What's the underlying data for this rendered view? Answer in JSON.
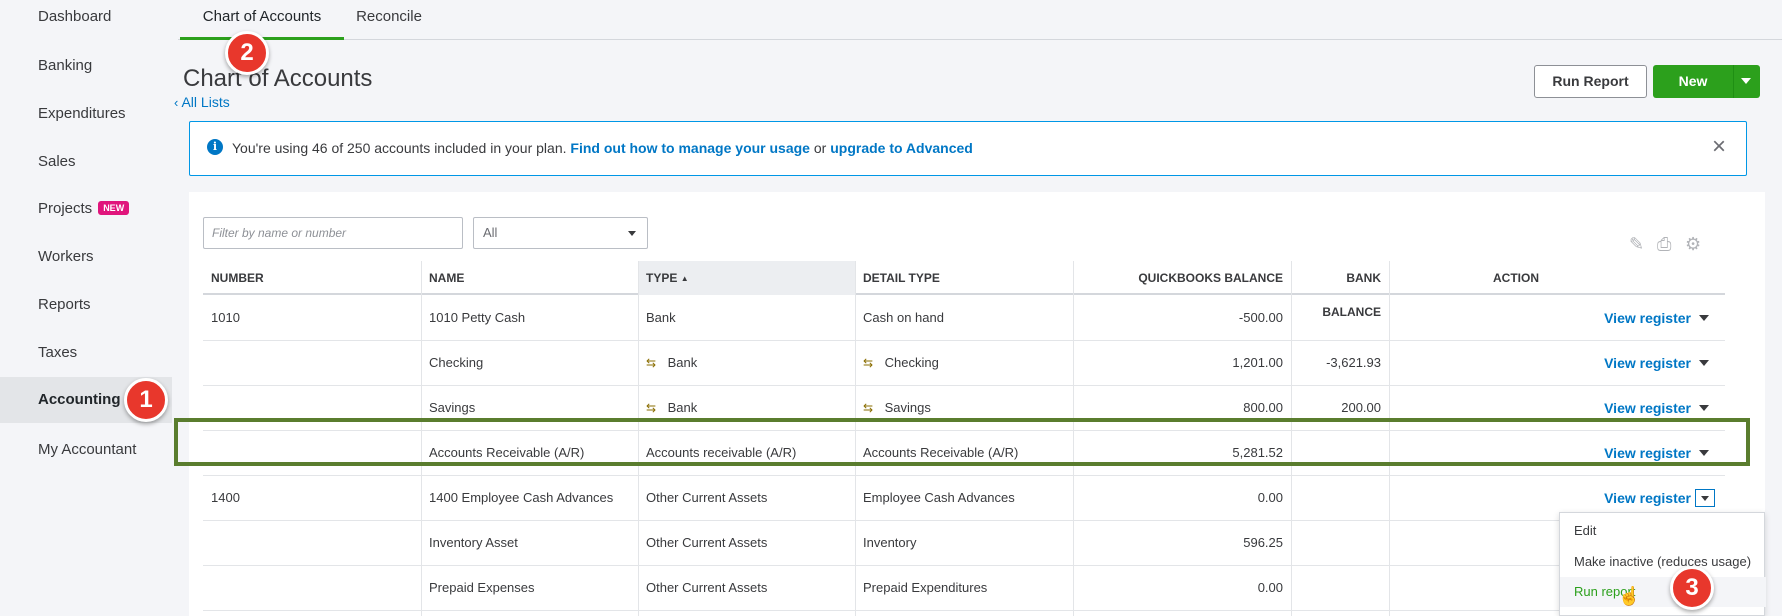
{
  "sidebar": {
    "items": [
      {
        "label": "Dashboard"
      },
      {
        "label": "Banking"
      },
      {
        "label": "Expenditures"
      },
      {
        "label": "Sales"
      },
      {
        "label": "Projects",
        "badge": "NEW"
      },
      {
        "label": "Workers"
      },
      {
        "label": "Reports"
      },
      {
        "label": "Taxes"
      },
      {
        "label": "Accounting",
        "active": true
      },
      {
        "label": "My Accountant"
      }
    ]
  },
  "tabs": [
    {
      "label": "Chart of Accounts",
      "active": true
    },
    {
      "label": "Reconcile"
    }
  ],
  "page": {
    "title": "Chart of Accounts",
    "back_link": "All Lists",
    "run_report_label": "Run Report",
    "new_label": "New"
  },
  "banner": {
    "text": "You're using 46 of 250 accounts included in your plan.",
    "link1": "Find out how to manage your usage",
    "or": "or",
    "link2": "upgrade to Advanced",
    "close": "×"
  },
  "filters": {
    "search_placeholder": "Filter by name or number",
    "type_value": "All"
  },
  "table": {
    "headers": {
      "number": "NUMBER",
      "name": "NAME",
      "type": "TYPE",
      "detail_type": "DETAIL TYPE",
      "qb_balance": "QUICKBOOKS BALANCE",
      "bank_balance": "BANK BALANCE",
      "action": "ACTION"
    },
    "sort_indicator": "▲",
    "action_label": "View register",
    "rows": [
      {
        "number": "1010",
        "name": "1010 Petty Cash",
        "type": "Bank",
        "detail": "Cash on hand",
        "qb": "-500.00",
        "bank": ""
      },
      {
        "number": "",
        "name": "Checking",
        "type": "Bank",
        "detail": "Checking",
        "qb": "1,201.00",
        "bank": "-3,621.93"
      },
      {
        "number": "",
        "name": "Savings",
        "type": "Bank",
        "detail": "Savings",
        "qb": "800.00",
        "bank": "200.00"
      },
      {
        "number": "",
        "name": "Accounts Receivable (A/R)",
        "type": "Accounts receivable (A/R)",
        "detail": "Accounts Receivable (A/R)",
        "qb": "5,281.52",
        "bank": ""
      },
      {
        "number": "1400",
        "name": "1400 Employee Cash Advances",
        "type": "Other Current Assets",
        "detail": "Employee Cash Advances",
        "qb": "0.00",
        "bank": ""
      },
      {
        "number": "",
        "name": "Inventory Asset",
        "type": "Other Current Assets",
        "detail": "Inventory",
        "qb": "596.25",
        "bank": ""
      },
      {
        "number": "",
        "name": "Prepaid Expenses",
        "type": "Other Current Assets",
        "detail": "Prepaid Expenditures",
        "qb": "0.00",
        "bank": ""
      }
    ]
  },
  "action_menu": {
    "items": [
      "Edit",
      "Make inactive (reduces usage)",
      "Run report"
    ]
  },
  "markers": [
    "1",
    "2",
    "3"
  ],
  "colors": {
    "accent_green": "#2ca01c",
    "link_blue": "#0077c5",
    "highlight_border": "#5a7d2e",
    "marker_red": "#e8372c",
    "new_badge": "#e0157c"
  }
}
